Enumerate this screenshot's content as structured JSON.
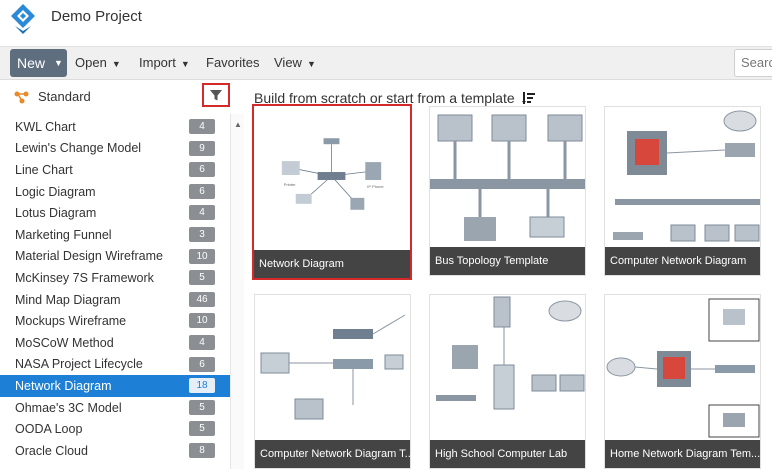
{
  "app": {
    "title": "Demo Project"
  },
  "toolbar": {
    "new_label": "New",
    "open_label": "Open",
    "import_label": "Import",
    "favorites_label": "Favorites",
    "view_label": "View",
    "search_placeholder": "Search"
  },
  "sidebar": {
    "header_label": "Standard",
    "items": [
      {
        "label": "KWL Chart",
        "count": "4"
      },
      {
        "label": "Lewin's Change Model",
        "count": "9"
      },
      {
        "label": "Line Chart",
        "count": "6"
      },
      {
        "label": "Logic Diagram",
        "count": "6"
      },
      {
        "label": "Lotus Diagram",
        "count": "4"
      },
      {
        "label": "Marketing Funnel",
        "count": "3"
      },
      {
        "label": "Material Design Wireframe",
        "count": "10"
      },
      {
        "label": "McKinsey 7S Framework",
        "count": "5"
      },
      {
        "label": "Mind Map Diagram",
        "count": "46"
      },
      {
        "label": "Mockups Wireframe",
        "count": "10"
      },
      {
        "label": "MoSCoW Method",
        "count": "4"
      },
      {
        "label": "NASA Project Lifecycle",
        "count": "6"
      },
      {
        "label": "Network Diagram",
        "count": "18"
      },
      {
        "label": "Ohmae's 3C Model",
        "count": "5"
      },
      {
        "label": "OODA Loop",
        "count": "5"
      },
      {
        "label": "Oracle Cloud",
        "count": "8"
      }
    ],
    "active_index": 12
  },
  "main": {
    "title": "Build from scratch or start from a template",
    "templates": [
      {
        "label": "Network Diagram"
      },
      {
        "label": "Bus Topology Template"
      },
      {
        "label": "Computer Network Diagram"
      },
      {
        "label": "Computer Network Diagram T..."
      },
      {
        "label": "High School Computer Lab"
      },
      {
        "label": "Home Network Diagram Tem..."
      }
    ]
  },
  "colors": {
    "accent": "#1e7fd6",
    "selection": "#d42a2a",
    "new_button": "#5e6e7e"
  }
}
